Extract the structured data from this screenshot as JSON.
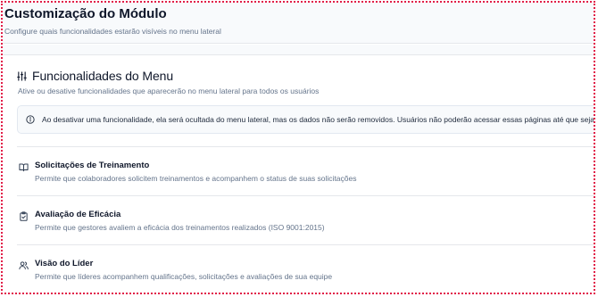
{
  "header": {
    "title": "Customização do Módulo",
    "subtitle": "Configure quais funcionalidades estarão visíveis no menu lateral"
  },
  "section": {
    "icon": "sliders-icon",
    "title": "Funcionalidades do Menu",
    "description": "Ative ou desative funcionalidades que aparecerão no menu lateral para todos os usuários"
  },
  "alert": {
    "icon": "info-icon",
    "text": "Ao desativar uma funcionalidade, ela será ocultada do menu lateral, mas os dados não serão removidos. Usuários não poderão acessar essas páginas até que sejam reativadas."
  },
  "features": [
    {
      "icon": "book-open-icon",
      "title": "Solicitações de Treinamento",
      "description": "Permite que colaboradores solicitem treinamentos e acompanhem o status de suas solicitações"
    },
    {
      "icon": "clipboard-check-icon",
      "title": "Avaliação de Eficácia",
      "description": "Permite que gestores avaliem a eficácia dos treinamentos realizados (ISO 9001:2015)"
    },
    {
      "icon": "users-icon",
      "title": "Visão do Líder",
      "description": "Permite que líderes acompanhem qualificações, solicitações e avaliações de sua equipe"
    }
  ],
  "colors": {
    "text_primary": "#0f172a",
    "text_muted": "#64748b",
    "border": "#e5e7eb",
    "frame_outline": "#e11d48"
  }
}
